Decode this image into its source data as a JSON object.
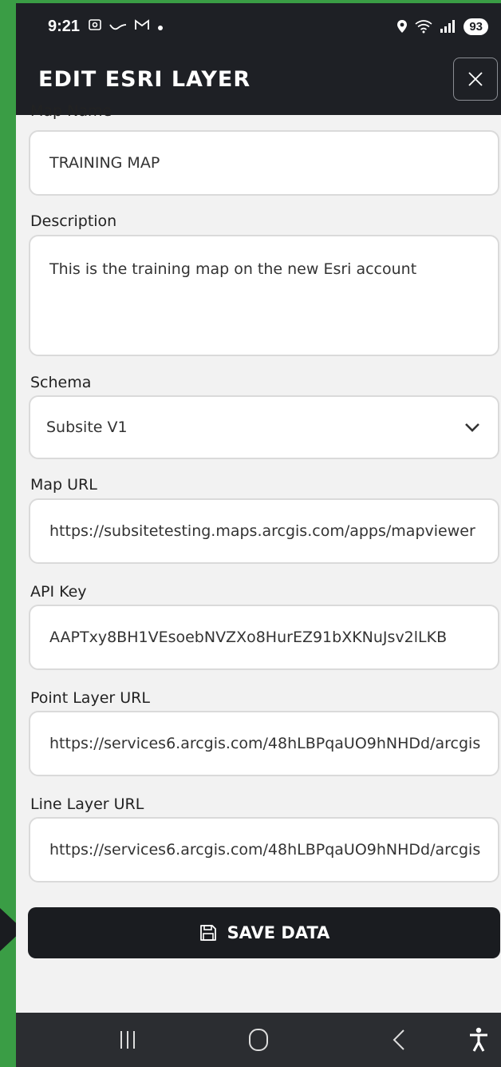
{
  "status": {
    "time": "9:21",
    "notif_icons": [
      "screenshot-icon",
      "wave-icon",
      "gmail-icon",
      "dot-icon"
    ],
    "right_icons": [
      "location-icon",
      "wifi-icon",
      "signal-icon"
    ],
    "battery": "93"
  },
  "header": {
    "title": "EDIT ESRI LAYER"
  },
  "form": {
    "map_name": {
      "label": "Map Name",
      "value": "TRAINING MAP"
    },
    "description": {
      "label": "Description",
      "value": "This is the training map on the new Esri account"
    },
    "schema": {
      "label": "Schema",
      "value": "Subsite V1"
    },
    "map_url": {
      "label": "Map URL",
      "value": "https://subsitetesting.maps.arcgis.com/apps/mapviewer"
    },
    "api_key": {
      "label": "API Key",
      "value": "AAPTxy8BH1VEsoebNVZXo8HurEZ91bXKNuJsv2lLKB"
    },
    "point_layer_url": {
      "label": "Point Layer URL",
      "value": "https://services6.arcgis.com/48hLBPqaUO9hNHDd/arcgis"
    },
    "line_layer_url": {
      "label": "Line Layer URL",
      "value": "https://services6.arcgis.com/48hLBPqaUO9hNHDd/arcgis"
    }
  },
  "save_button": {
    "label": "SAVE DATA"
  },
  "colors": {
    "header": "#1e2025",
    "accent_green": "#3a9d45",
    "background": "#f2f2f2"
  }
}
